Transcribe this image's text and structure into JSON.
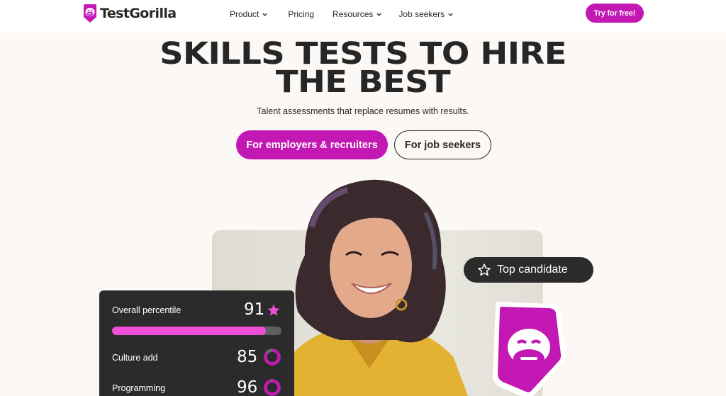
{
  "nav": {
    "logo": "TestGorilla",
    "items": [
      {
        "label": "Product",
        "dropdown": true
      },
      {
        "label": "Pricing",
        "dropdown": false
      },
      {
        "label": "Resources",
        "dropdown": true
      },
      {
        "label": "Job seekers",
        "dropdown": true
      }
    ],
    "cta": "Try for free!"
  },
  "hero": {
    "title_line1": "SKILLS TESTS TO HIRE",
    "title_line2": "THE BEST",
    "subtitle": "Talent assessments that replace resumes with results.",
    "primary_cta": "For employers & recruiters",
    "secondary_cta": "For job seekers"
  },
  "badge": {
    "label": "Top candidate",
    "icon": "star-outline-icon"
  },
  "scorecard": {
    "overall": {
      "label": "Overall percentile",
      "value": "91",
      "percent": 91,
      "icon": "star-icon"
    },
    "rows": [
      {
        "label": "Culture add",
        "value": "85",
        "percent": 85
      },
      {
        "label": "Programming",
        "value": "96",
        "percent": 96
      }
    ]
  },
  "colors": {
    "brand": "#c318b3",
    "bar_fill": "#ef4fd6",
    "card_bg": "#2b2b2b",
    "page_bg": "#fbf8f5"
  }
}
